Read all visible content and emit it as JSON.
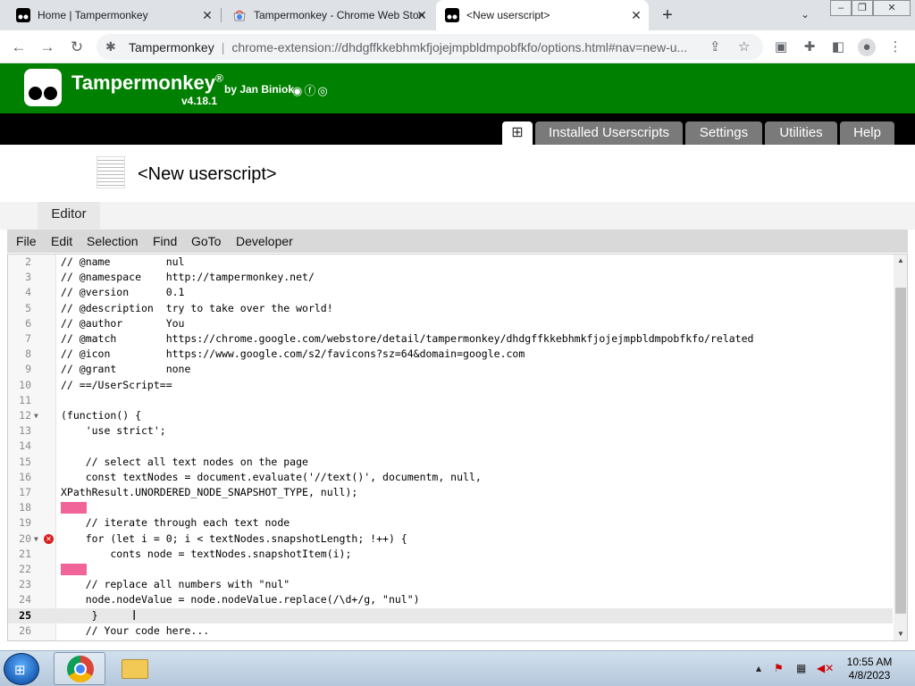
{
  "browser": {
    "tabs": [
      {
        "title": "Home | Tampermonkey",
        "icon": "tampermonkey-icon"
      },
      {
        "title": "Tampermonkey - Chrome Web Store",
        "icon": "chrome-webstore-icon"
      },
      {
        "title": "<New userscript>",
        "icon": "tampermonkey-icon",
        "active": true
      }
    ],
    "new_tab_symbol": "+",
    "tab_list_symbol": "⌄",
    "site_name": "Tampermonkey",
    "url": "chrome-extension://dhdgffkkebhmkfjojejmpbldmpobfkfo/options.html#nav=new-u...",
    "window_controls": [
      "‒",
      "❐",
      "✕"
    ]
  },
  "tm_header": {
    "title": "Tampermonkey",
    "registered": "®",
    "by": "by Jan Biniok",
    "version": "v4.18.1",
    "social_icons": [
      "github-icon",
      "facebook-icon",
      "instagram-icon"
    ]
  },
  "tm_nav": {
    "plus_symbol": "⊞",
    "tabs": [
      "Installed Userscripts",
      "Settings",
      "Utilities",
      "Help"
    ]
  },
  "script": {
    "title": "<New userscript>",
    "editor_tab": "Editor"
  },
  "menu": [
    "File",
    "Edit",
    "Selection",
    "Find",
    "GoTo",
    "Developer"
  ],
  "code_lines": [
    {
      "n": "2",
      "text": "// @name         nul"
    },
    {
      "n": "3",
      "text": "// @namespace    http://tampermonkey.net/"
    },
    {
      "n": "4",
      "text": "// @version      0.1"
    },
    {
      "n": "5",
      "text": "// @description  try to take over the world!"
    },
    {
      "n": "6",
      "text": "// @author       You"
    },
    {
      "n": "7",
      "text": "// @match        https://chrome.google.com/webstore/detail/tampermonkey/dhdgffkkebhmkfjojejmpbldmpobfkfo/related"
    },
    {
      "n": "8",
      "text": "// @icon         https://www.google.com/s2/favicons?sz=64&domain=google.com"
    },
    {
      "n": "9",
      "text": "// @grant        none"
    },
    {
      "n": "10",
      "text": "// ==/UserScript=="
    },
    {
      "n": "11",
      "text": ""
    },
    {
      "n": "12",
      "text": "(function() {"
    },
    {
      "n": "13",
      "text": "    'use strict';"
    },
    {
      "n": "14",
      "text": ""
    },
    {
      "n": "15",
      "text": "    // select all text nodes on the page"
    },
    {
      "n": "16",
      "text": "    const textNodes = document.evaluate('//text()', documentm, null,"
    },
    {
      "n": "17",
      "text": "XPathResult.UNORDERED_NODE_SNAPSHOT_TYPE, null);"
    },
    {
      "n": "18",
      "text": ""
    },
    {
      "n": "19",
      "text": "    // iterate through each text node"
    },
    {
      "n": "20",
      "text": "    for (let i = 0; i < textNodes.snapshotLength; !++) {"
    },
    {
      "n": "21",
      "text": "        conts node = textNodes.snapshotItem(i);"
    },
    {
      "n": "22",
      "text": ""
    },
    {
      "n": "23",
      "text": "    // replace all numbers with \"nul\""
    },
    {
      "n": "24",
      "text": "    node.nodeValue = node.nodeValue.replace(/\\d+/g, \"nul\")"
    },
    {
      "n": "25",
      "text": "     }"
    },
    {
      "n": "26",
      "text": "    // Your code here..."
    }
  ],
  "taskbar": {
    "time": "10:55 AM",
    "date": "4/8/2023",
    "tray_icons": [
      "show-hidden-icon",
      "action-center-icon",
      "network-icon",
      "volume-muted-icon"
    ]
  },
  "colors": {
    "tm_green": "#008000",
    "tm_nav_black": "#000000",
    "tm_tab_grey": "#7a7a7a",
    "error_red": "#d92020",
    "highlight_pink": "#f0649a"
  }
}
